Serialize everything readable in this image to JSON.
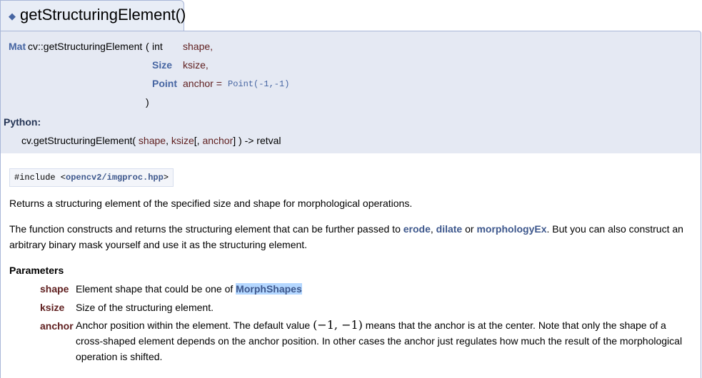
{
  "header": {
    "diamond": "◆",
    "title": "getStructuringElement()"
  },
  "prototype": {
    "return_type": "Mat",
    "function_name": "cv::getStructuringElement",
    "open_paren": "(",
    "params": [
      {
        "type": "int",
        "name": "shape,"
      },
      {
        "type": "Size",
        "name": "ksize,"
      },
      {
        "type": "Point",
        "name": "anchor =",
        "default": "Point(-1,-1)"
      }
    ],
    "close_paren": ")"
  },
  "python": {
    "label": "Python:",
    "sig_prefix": "cv.getStructuringElement(",
    "arg1": "shape",
    "sep1": ",",
    "arg2": "ksize",
    "opt_open": "[,",
    "arg3": "anchor",
    "opt_close": "] ) -> retval"
  },
  "include": {
    "prefix": "#include <",
    "file": "opencv2/imgproc.hpp",
    "suffix": ">"
  },
  "description": {
    "brief": "Returns a structuring element of the specified size and shape for morphological operations.",
    "detail_part1": "The function constructs and returns the structuring element that can be further passed to ",
    "link_erode": "erode",
    "comma": ", ",
    "link_dilate": "dilate",
    "or": " or ",
    "link_morphologyex": "morphologyEx",
    "detail_part2": ". But you can also construct an",
    "detail_line2": "arbitrary binary mask yourself and use it as the structuring element."
  },
  "parameters": {
    "heading": "Parameters",
    "items": [
      {
        "name": "shape",
        "desc": "Element shape that could be one of ",
        "link": "MorphShapes"
      },
      {
        "name": "ksize",
        "desc": "Size of the structuring element."
      },
      {
        "name": "anchor",
        "desc_part1": "Anchor position within the element. The default value ",
        "math": "(−1, −1)",
        "desc_part2": " means that the anchor is at the center. Note that only the shape of a",
        "desc_line2": "cross-shaped element depends on the anchor position. In other cases the anchor just regulates how much the result of the morphological",
        "desc_line3": "operation is shifted."
      }
    ]
  }
}
